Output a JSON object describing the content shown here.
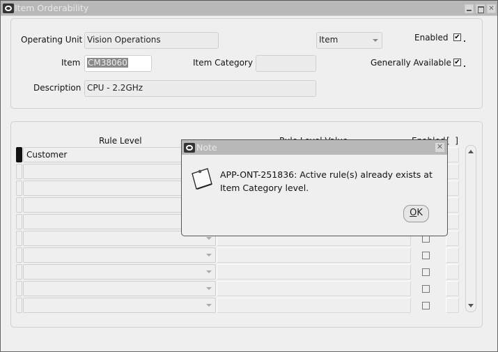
{
  "window": {
    "title": "Item Orderability",
    "controls": [
      "minimize",
      "maximize",
      "close"
    ]
  },
  "header_form": {
    "operating_unit": {
      "label": "Operating Unit",
      "value": "Vision Operations"
    },
    "rule_type_select": {
      "value": "Item"
    },
    "enabled": {
      "label": "Enabled",
      "checked": true
    },
    "item": {
      "label": "Item",
      "value": "CM38060"
    },
    "item_category": {
      "label": "Item Category",
      "value": ""
    },
    "generally_available": {
      "label": "Generally Available",
      "checked": true
    },
    "description": {
      "label": "Description",
      "value": "CPU - 2.2GHz"
    }
  },
  "rules_table": {
    "columns": {
      "rule_level": "Rule Level",
      "rule_level_value": "Rule Level Value",
      "enabled": "Enabled"
    },
    "rows": [
      {
        "rule_level": "Customer",
        "rule_level_value": "",
        "enabled": false
      },
      {
        "rule_level": "",
        "rule_level_value": "",
        "enabled": false
      },
      {
        "rule_level": "",
        "rule_level_value": "",
        "enabled": false
      },
      {
        "rule_level": "",
        "rule_level_value": "",
        "enabled": false
      },
      {
        "rule_level": "",
        "rule_level_value": "",
        "enabled": false
      },
      {
        "rule_level": "",
        "rule_level_value": "",
        "enabled": false
      },
      {
        "rule_level": "",
        "rule_level_value": "",
        "enabled": false
      },
      {
        "rule_level": "",
        "rule_level_value": "",
        "enabled": false
      },
      {
        "rule_level": "",
        "rule_level_value": "",
        "enabled": false
      },
      {
        "rule_level": "",
        "rule_level_value": "",
        "enabled": false
      }
    ]
  },
  "dialog": {
    "title": "Note",
    "icon": "note-icon",
    "message": "APP-ONT-251836: Active rule(s) already exists at Item Category level.",
    "ok_mnemonic": "O",
    "ok_rest": "K"
  },
  "icons": {
    "checkmark": "✔",
    "close": "✕"
  }
}
